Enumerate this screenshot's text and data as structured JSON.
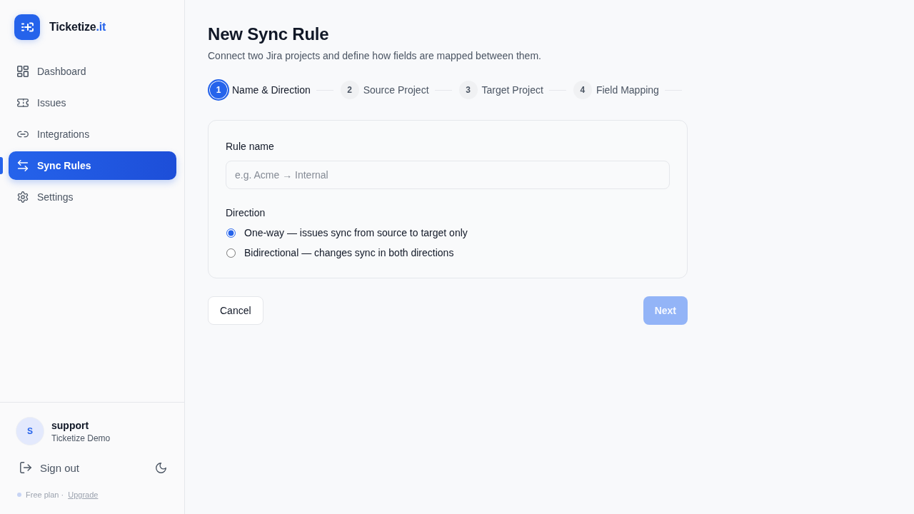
{
  "sidebar": {
    "brand": {
      "name": "Ticketize",
      "suffix": ".it"
    },
    "nav": [
      {
        "label": "Dashboard",
        "selected": false
      },
      {
        "label": "Issues",
        "selected": false
      },
      {
        "label": "Integrations",
        "selected": false
      },
      {
        "label": "Sync Rules",
        "selected": true
      },
      {
        "label": "Settings",
        "selected": false
      }
    ],
    "user": {
      "initial": "S",
      "name": "support",
      "org": "Ticketize Demo"
    },
    "sign_out": "Sign out",
    "plan": {
      "label": "Free plan ·",
      "link": "Upgrade"
    }
  },
  "page": {
    "title": "New Sync Rule",
    "subtitle": "Connect two Jira projects and define how fields are mapped between them."
  },
  "steps": [
    {
      "number": "1",
      "label": "Name & Direction",
      "selected": true
    },
    {
      "number": "2",
      "label": "Source Project",
      "selected": false
    },
    {
      "number": "3",
      "label": "Target Project",
      "selected": false
    },
    {
      "number": "4",
      "label": "Field Mapping",
      "selected": false
    }
  ],
  "form": {
    "rule_name": {
      "label": "Rule name",
      "placeholder": "e.g. Acme → Internal"
    },
    "direction": {
      "label": "Direction",
      "options": [
        {
          "label": "One-way — issues sync from source to target only",
          "selected": true
        },
        {
          "label": "Bidirectional — changes sync in both directions",
          "selected": false
        }
      ]
    }
  },
  "buttons": {
    "cancel": {
      "label": "Cancel"
    },
    "next": {
      "label": "Next",
      "disabled": true
    }
  }
}
